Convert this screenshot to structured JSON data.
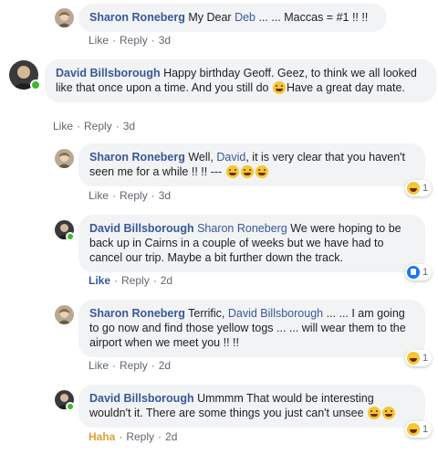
{
  "comments": [
    {
      "name": "Sharon Roneberg",
      "text_a": " My Dear ",
      "tag": "Deb",
      "text_b": " ... ... Maccas = #1 !! !!",
      "like": "Like",
      "reply": "Reply",
      "time": "3d"
    },
    {
      "name": "David Billsborough",
      "text_a": " Happy birthday Geoff.  Geez, to think we all looked like that once upon a time. And you still do ",
      "text_b": "Have a great day mate.",
      "like": "Like",
      "reply": "Reply",
      "time": "3d"
    },
    {
      "name": "Sharon Roneberg",
      "text_a": " Well, ",
      "tag": "David",
      "text_b": ", it is very clear that you haven't seen me for a while !! !! --- ",
      "like": "Like",
      "reply": "Reply",
      "time": "3d",
      "reaction_count": "1",
      "reaction_icon": "haha-reaction-icon"
    },
    {
      "name": "David Billsborough",
      "tag": "Sharon Roneberg",
      "text_b": " We were hoping to be back up in Cairns in a couple of weeks but we have had to cancel our trip. Maybe a bit further down the track.",
      "like": "Like",
      "reply": "Reply",
      "time": "2d",
      "reaction_count": "1",
      "reaction_icon": "like-reaction-icon"
    },
    {
      "name": "Sharon Roneberg",
      "text_a": " Terrific, ",
      "tag": "David Billsborough",
      "text_b": " ... ... I am going to go now and find those yellow togs ... ... will wear them to the airport when we meet you !! !!",
      "like": "Like",
      "reply": "Reply",
      "time": "2d",
      "reaction_count": "1",
      "reaction_icon": "haha-reaction-icon"
    },
    {
      "name": "David Billsborough",
      "text_a": " Ummmm That would be interesting wouldn't it. There are some things you just can't unsee ",
      "like": "Haha",
      "reply": "Reply",
      "time": "2d",
      "reaction_count": "1",
      "reaction_icon": "haha-reaction-icon"
    }
  ],
  "colors": {
    "name": "#385898",
    "bubble": "#f2f3f5",
    "online": "#42b72a",
    "haha": "#d9a333"
  }
}
